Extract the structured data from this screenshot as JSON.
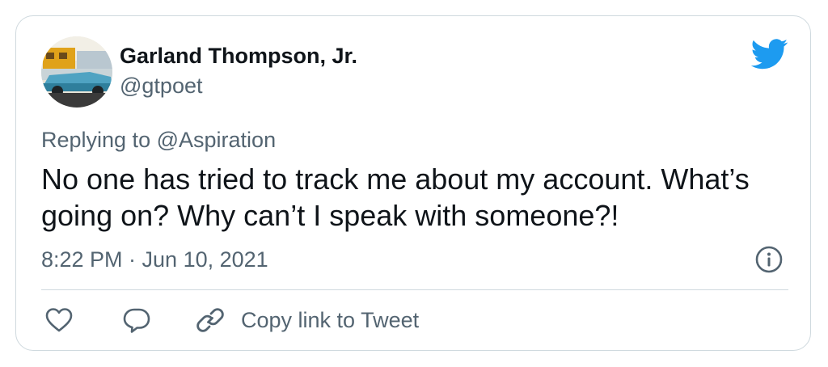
{
  "author": {
    "name": "Garland Thompson, Jr.",
    "handle": "@gtpoet",
    "avatar_icon": "avatar-photo-classic-car"
  },
  "brand": {
    "logo_icon": "twitter-bird-icon",
    "accent_color": "#1d9bf0"
  },
  "reply": {
    "prefix": "Replying to",
    "handle": "@Aspiration"
  },
  "tweet": {
    "text": "No one has tried to track me about my account. What’s going on? Why can’t I speak with someone?!",
    "timestamp": "8:22 PM · Jun 10, 2021"
  },
  "actions": {
    "like_icon": "heart-icon",
    "reply_icon": "speech-bubble-icon",
    "copy_link_icon": "link-icon",
    "copy_link_label": "Copy link to Tweet",
    "info_icon": "info-icon"
  },
  "colors": {
    "text_primary": "#0f1419",
    "text_secondary": "#536471",
    "border": "#cfd9de"
  }
}
